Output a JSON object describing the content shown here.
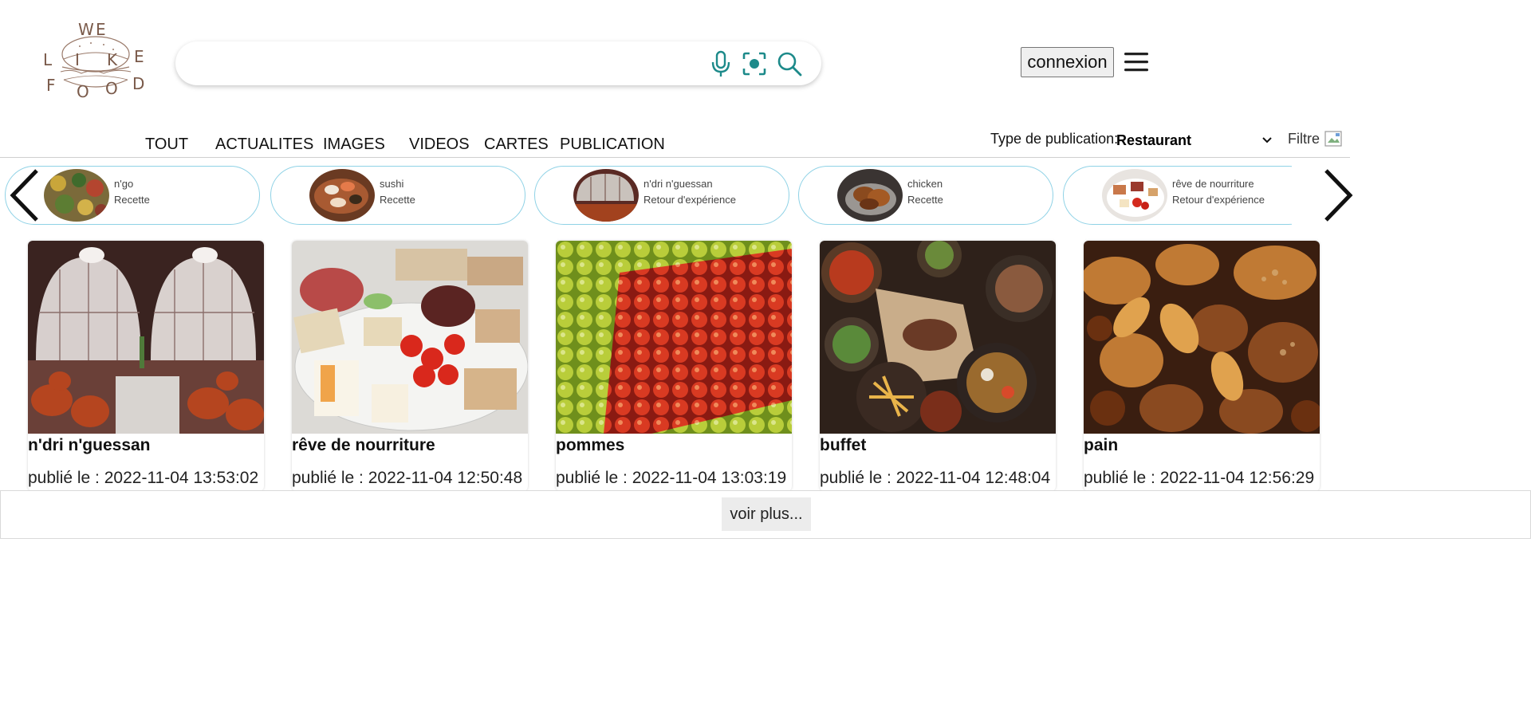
{
  "logo": {
    "letters": [
      "W",
      "E",
      "L",
      "I",
      "K",
      "E",
      "F",
      "O",
      "O",
      "D"
    ],
    "icon": "burger-icon"
  },
  "search": {
    "value": "",
    "placeholder": "",
    "icons": [
      "microphone-icon",
      "image-lens-icon",
      "search-icon"
    ]
  },
  "header": {
    "login_label": "connexion",
    "menu_icon": "hamburger-menu-icon"
  },
  "tabs": [
    "TOUT",
    "ACTUALITES",
    "IMAGES",
    "VIDEOS",
    "CARTES",
    "PUBLICATION"
  ],
  "publication_filter": {
    "label": "Type de  publication:",
    "selected": "Restaurant",
    "filter_label": "Filtre"
  },
  "chips": [
    {
      "name": "n'go",
      "type": "Recette"
    },
    {
      "name": "sushi",
      "type": "Recette"
    },
    {
      "name": "n'dri n'guessan",
      "type": "Retour d'expérience"
    },
    {
      "name": "chicken",
      "type": "Recette"
    },
    {
      "name": "rêve de nourriture",
      "type": "Retour d'expérience"
    }
  ],
  "cards": [
    {
      "title": "n'dri n'guessan",
      "date": "publié le : 2022-11-04 13:53:02"
    },
    {
      "title": "rêve de nourriture",
      "date": "publié le : 2022-11-04 12:50:48"
    },
    {
      "title": "pommes",
      "date": "publié le : 2022-11-04 13:03:19"
    },
    {
      "title": "buffet",
      "date": "publié le : 2022-11-04 12:48:04"
    },
    {
      "title": "pain",
      "date": "publié le : 2022-11-04 12:56:29"
    }
  ],
  "more_label": "voir plus...",
  "colors": {
    "accent": "#1d8a8a",
    "chip_border": "#8fd2e6",
    "logo": "#7a5a4a"
  }
}
